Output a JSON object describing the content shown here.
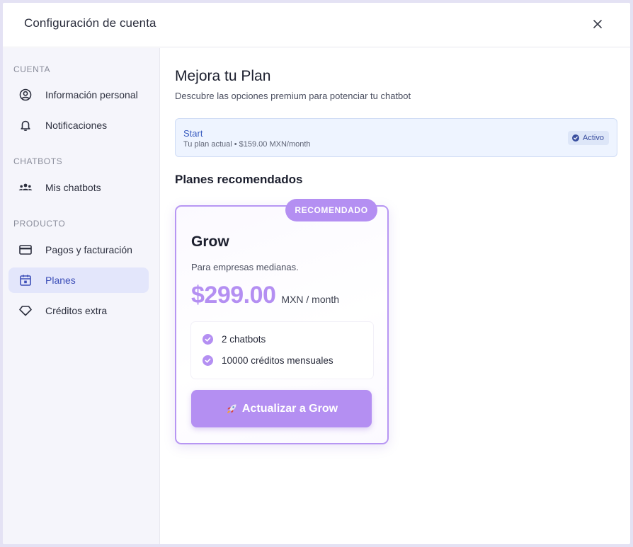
{
  "header": {
    "title": "Configuración de cuenta",
    "close_icon": "close-icon"
  },
  "sidebar": {
    "sections": [
      {
        "label": "CUENTA",
        "items": [
          {
            "label": "Información personal",
            "icon": "user-circle-icon"
          },
          {
            "label": "Notificaciones",
            "icon": "bell-icon"
          }
        ]
      },
      {
        "label": "CHATBOTS",
        "items": [
          {
            "label": "Mis chatbots",
            "icon": "users-group-icon"
          }
        ]
      },
      {
        "label": "PRODUCTO",
        "items": [
          {
            "label": "Pagos y facturación",
            "icon": "credit-card-icon"
          },
          {
            "label": "Planes",
            "icon": "calendar-icon",
            "active": true
          },
          {
            "label": "Créditos extra",
            "icon": "diamond-icon"
          }
        ]
      }
    ]
  },
  "main": {
    "title": "Mejora tu Plan",
    "subtitle": "Descubre las opciones premium para potenciar tu chatbot",
    "current_plan": {
      "name": "Start",
      "detail": "Tu plan actual • $159.00 MXN/month",
      "status": "Activo",
      "status_icon": "check-circle-icon"
    },
    "recommended_title": "Planes recomendados",
    "plan": {
      "badge": "RECOMENDADO",
      "name": "Grow",
      "description": "Para empresas medianas.",
      "price": "$299.00",
      "price_unit": "MXN / month",
      "features": [
        "2 chatbots",
        "10000 créditos mensuales"
      ],
      "feature_icon": "check-circle-icon",
      "cta_label": "Actualizar a Grow",
      "cta_icon": "rocket-icon"
    }
  },
  "colors": {
    "accent": "#b48ff2",
    "active_nav_bg": "#e3e6fb",
    "active_nav_text": "#3d4fb8",
    "current_plan_bg": "#eef4ff"
  }
}
